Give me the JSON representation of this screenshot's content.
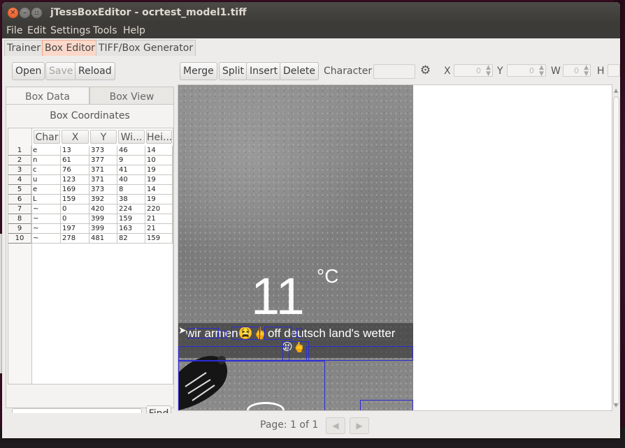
{
  "window": {
    "title": "jTessBoxEditor - ocrtest_model1.tiff"
  },
  "menu": [
    "File",
    "Edit",
    "Settings",
    "Tools",
    "Help"
  ],
  "tabs": [
    "Trainer",
    "Box Editor",
    "TIFF/Box Generator"
  ],
  "active_tab": "Box Editor",
  "toolbar": {
    "open": "Open",
    "save": "Save",
    "reload": "Reload",
    "merge": "Merge",
    "split": "Split",
    "insert": "Insert",
    "delete": "Delete",
    "character_label": "Character",
    "character_value": "",
    "x_label": "X",
    "x_value": "0",
    "y_label": "Y",
    "y_value": "0",
    "w_label": "W",
    "w_value": "0",
    "h_label": "H"
  },
  "panel": {
    "tabs": [
      "Box Data",
      "Box View"
    ],
    "title": "Box Coordinates",
    "columns": [
      "Char",
      "X",
      "Y",
      "Wi...",
      "Hei..."
    ],
    "rows": [
      [
        "1",
        "e",
        "13",
        "373",
        "46",
        "14"
      ],
      [
        "2",
        "n",
        "61",
        "377",
        "9",
        "10"
      ],
      [
        "3",
        "c",
        "76",
        "371",
        "41",
        "19"
      ],
      [
        "4",
        "u",
        "123",
        "371",
        "40",
        "19"
      ],
      [
        "5",
        "e",
        "169",
        "373",
        "8",
        "14"
      ],
      [
        "6",
        "L",
        "159",
        "392",
        "38",
        "19"
      ],
      [
        "7",
        "~",
        "0",
        "420",
        "224",
        "220"
      ],
      [
        "8",
        "~",
        "0",
        "399",
        "159",
        "21"
      ],
      [
        "9",
        "~",
        "197",
        "399",
        "163",
        "21"
      ],
      [
        "10",
        "~",
        "278",
        "481",
        "82",
        "159"
      ]
    ],
    "find_value": "",
    "find_button": "Find"
  },
  "image": {
    "temperature": "11",
    "unit": "°C",
    "caption_line1": "wir armen😫🖕off deutsch land's wetter",
    "caption_line2": "😫🖕"
  },
  "pagination": {
    "label": "Page: 1 of 1"
  },
  "colors": {
    "active_tab_bg": "#fbd8c9",
    "box_outline": "#2b2bd6",
    "titlebar": "#3c3b37"
  }
}
